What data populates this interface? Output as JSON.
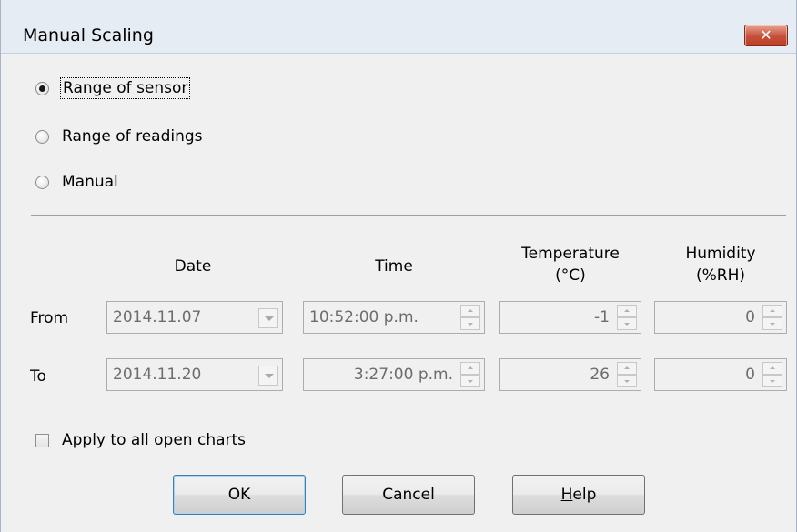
{
  "dialog": {
    "title": "Manual Scaling",
    "close_label": "✕"
  },
  "scaling_mode": {
    "options": [
      {
        "label": "Range of sensor",
        "selected": true
      },
      {
        "label": "Range of readings",
        "selected": false
      },
      {
        "label": "Manual",
        "selected": false
      }
    ]
  },
  "columns": {
    "date": "Date",
    "time": "Time",
    "temperature_line1": "Temperature",
    "temperature_line2": "(°C)",
    "humidity_line1": "Humidity",
    "humidity_line2": "(%RH)"
  },
  "rows": {
    "from": {
      "label": "From",
      "date": "2014.11.07",
      "time": "10:52:00 p.m.",
      "temperature": "-1",
      "humidity": "0"
    },
    "to": {
      "label": "To",
      "date": "2014.11.20",
      "time": "3:27:00 p.m.",
      "temperature": "26",
      "humidity": "0"
    }
  },
  "apply_all": {
    "label": "Apply to all open charts",
    "checked": false
  },
  "buttons": {
    "ok": "OK",
    "cancel": "Cancel",
    "help_mnemonic": "H",
    "help_rest": "elp"
  }
}
